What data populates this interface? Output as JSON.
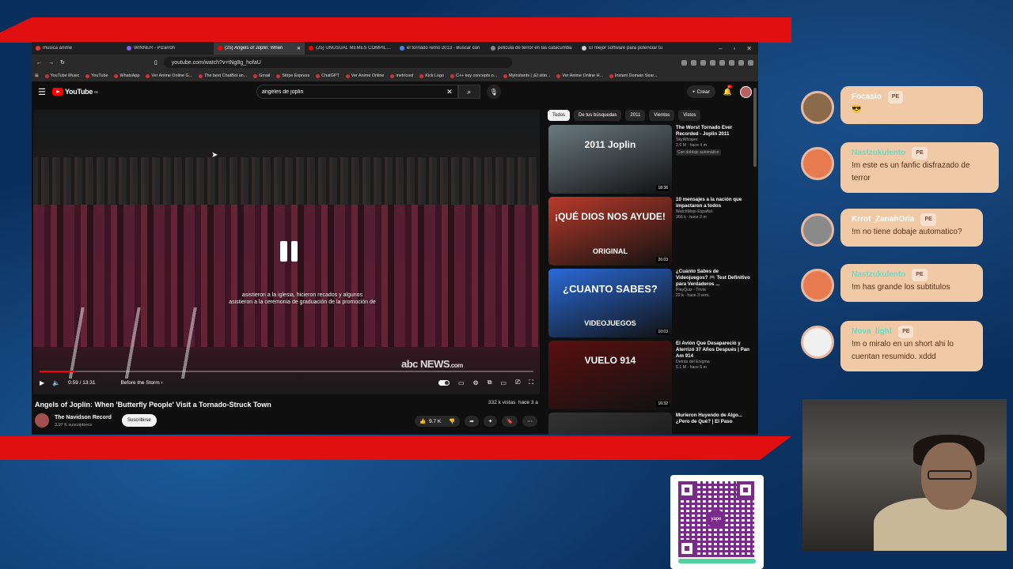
{
  "browser": {
    "tabs": [
      {
        "title": "musica anime",
        "color": "#e33"
      },
      {
        "title": "WINNER - Pizarrón",
        "color": "#8b5cf6"
      },
      {
        "title": "(25) Angels of Joplin: When",
        "color": "#f00",
        "active": true
      },
      {
        "title": "(25) UNUSUAL MEMES COMPILATI",
        "color": "#f00"
      },
      {
        "title": "el tornado remo 2013 - Buscar con",
        "color": "#4285f4"
      },
      {
        "title": "pelicula de terror en las catacumba",
        "color": "#888"
      },
      {
        "title": "El mejor software para potenciar tu",
        "color": "#ccc"
      }
    ],
    "url": "youtube.com/watch?v=tNg8g_hofaU",
    "bookmarks": [
      "YouTube Music",
      "YouTube",
      "WhatsApp",
      "Ver Anime Online G...",
      "The best ChatBot an...",
      "Gmail",
      "Stripe Express",
      "ChatGPT",
      "Ver Anime Online",
      "metricool",
      "Kick Logo",
      "C++ key concepts o...",
      "Myinstants | ¡El sitio...",
      "Ver Anime Online H...",
      "Instant Domain Sear..."
    ]
  },
  "youtube": {
    "logo": "YouTube",
    "logo_region": "PE",
    "search_value": "angeles de joplin",
    "create_label": "Crear",
    "notif_count": "9+"
  },
  "player": {
    "subtitle_line1": "asistieron a la iglesia, hicieron recados y algunos",
    "subtitle_line2": "asistieron a la ceremonia de graduación de la promoción de",
    "watermark": "abc NEWS",
    "watermark_suffix": ".com",
    "time": "0:59 / 13:31",
    "chapter": "Before the Storm",
    "progress": 0.073
  },
  "video": {
    "title": "Angels of Joplin: When 'Butterfly People' Visit a Tornado-Struck Town",
    "views": "332 k vistas",
    "age": "hace 3 a",
    "channel": "The Navidson Record",
    "subs": "3.97 K suscriptores",
    "subscribe_label": "Suscribirse",
    "likes": "9.7 K"
  },
  "sidebar": {
    "chips": [
      "Todos",
      "De tus búsquedas",
      "2011",
      "Vientos",
      "Vistos"
    ],
    "videos": [
      {
        "title": "The Worst Tornado Ever Recorded - Joplin 2011",
        "channel": "SkyWhisper",
        "meta": "2.6 M · hace 4 m",
        "tag": "Con doblaje automático",
        "duration": "18:36",
        "thumb_text": "2011 Joplin",
        "thumb_color": "#6a7a80"
      },
      {
        "title": "10 mensajes a la nación que impactaron a todos",
        "channel": "WatchMojo Español",
        "meta": "266 k · hace 2 m",
        "tag": "",
        "duration": "26:03",
        "thumb_text": "¡QUÉ DIOS NOS AYUDE!",
        "thumb_sub": "ORIGINAL",
        "thumb_color": "#b83a2a"
      },
      {
        "title": "¿Cuánto Sabes de Videojuegos? 🎮 Test Definitivo para Verdaderos ...",
        "channel": "PlayQuiz - Trivia",
        "meta": "22 k · hace 3 sem.",
        "tag": "",
        "duration": "10:03",
        "thumb_text": "¿CUANTO SABES?",
        "thumb_sub": "VIDEOJUEGOS",
        "thumb_color": "#2a6ad8"
      },
      {
        "title": "El Avión Que Desapareció y Aterrizó 37 Años Después | Pan Am 914",
        "channel": "Detrás del Enigma",
        "meta": "5.1 M · hace 6 m",
        "tag": "",
        "duration": "16:32",
        "thumb_text": "VUELO 914",
        "thumb_color": "#5a1010"
      },
      {
        "title": "Murieron Huyendo de Algo... ¿Pero de Qué? | El Paso",
        "channel": "",
        "meta": "",
        "tag": "",
        "duration": "",
        "thumb_text": "",
        "thumb_color": "#333"
      }
    ]
  },
  "chat": [
    {
      "name": "Focasio",
      "badge": "PE",
      "text": "😎",
      "av": "#8a6a4a",
      "name_color": "#fff"
    },
    {
      "name": "Nastzukulento",
      "badge": "PE",
      "text": "!m este es un fanfic disfrazado de terror",
      "av": "#e87a50",
      "name_color": "#5be0d0"
    },
    {
      "name": "Krrot_ZanahOria",
      "badge": "PE",
      "text": "!m no tiene dobaje automatico?",
      "av": "#8a8a8a",
      "name_color": "#fff"
    },
    {
      "name": "Nastzukulento",
      "badge": "PE",
      "text": "!m has grande los subtitulos",
      "av": "#e87a50",
      "name_color": "#5be0d0"
    },
    {
      "name": "Nova_light",
      "badge": "PE",
      "text": "!m o miralo en un short ahi lo cuentan resumido. xddd",
      "av": "#f0f0f0",
      "name_color": "#5be0d0"
    }
  ],
  "qr": {
    "logo": "yape"
  }
}
